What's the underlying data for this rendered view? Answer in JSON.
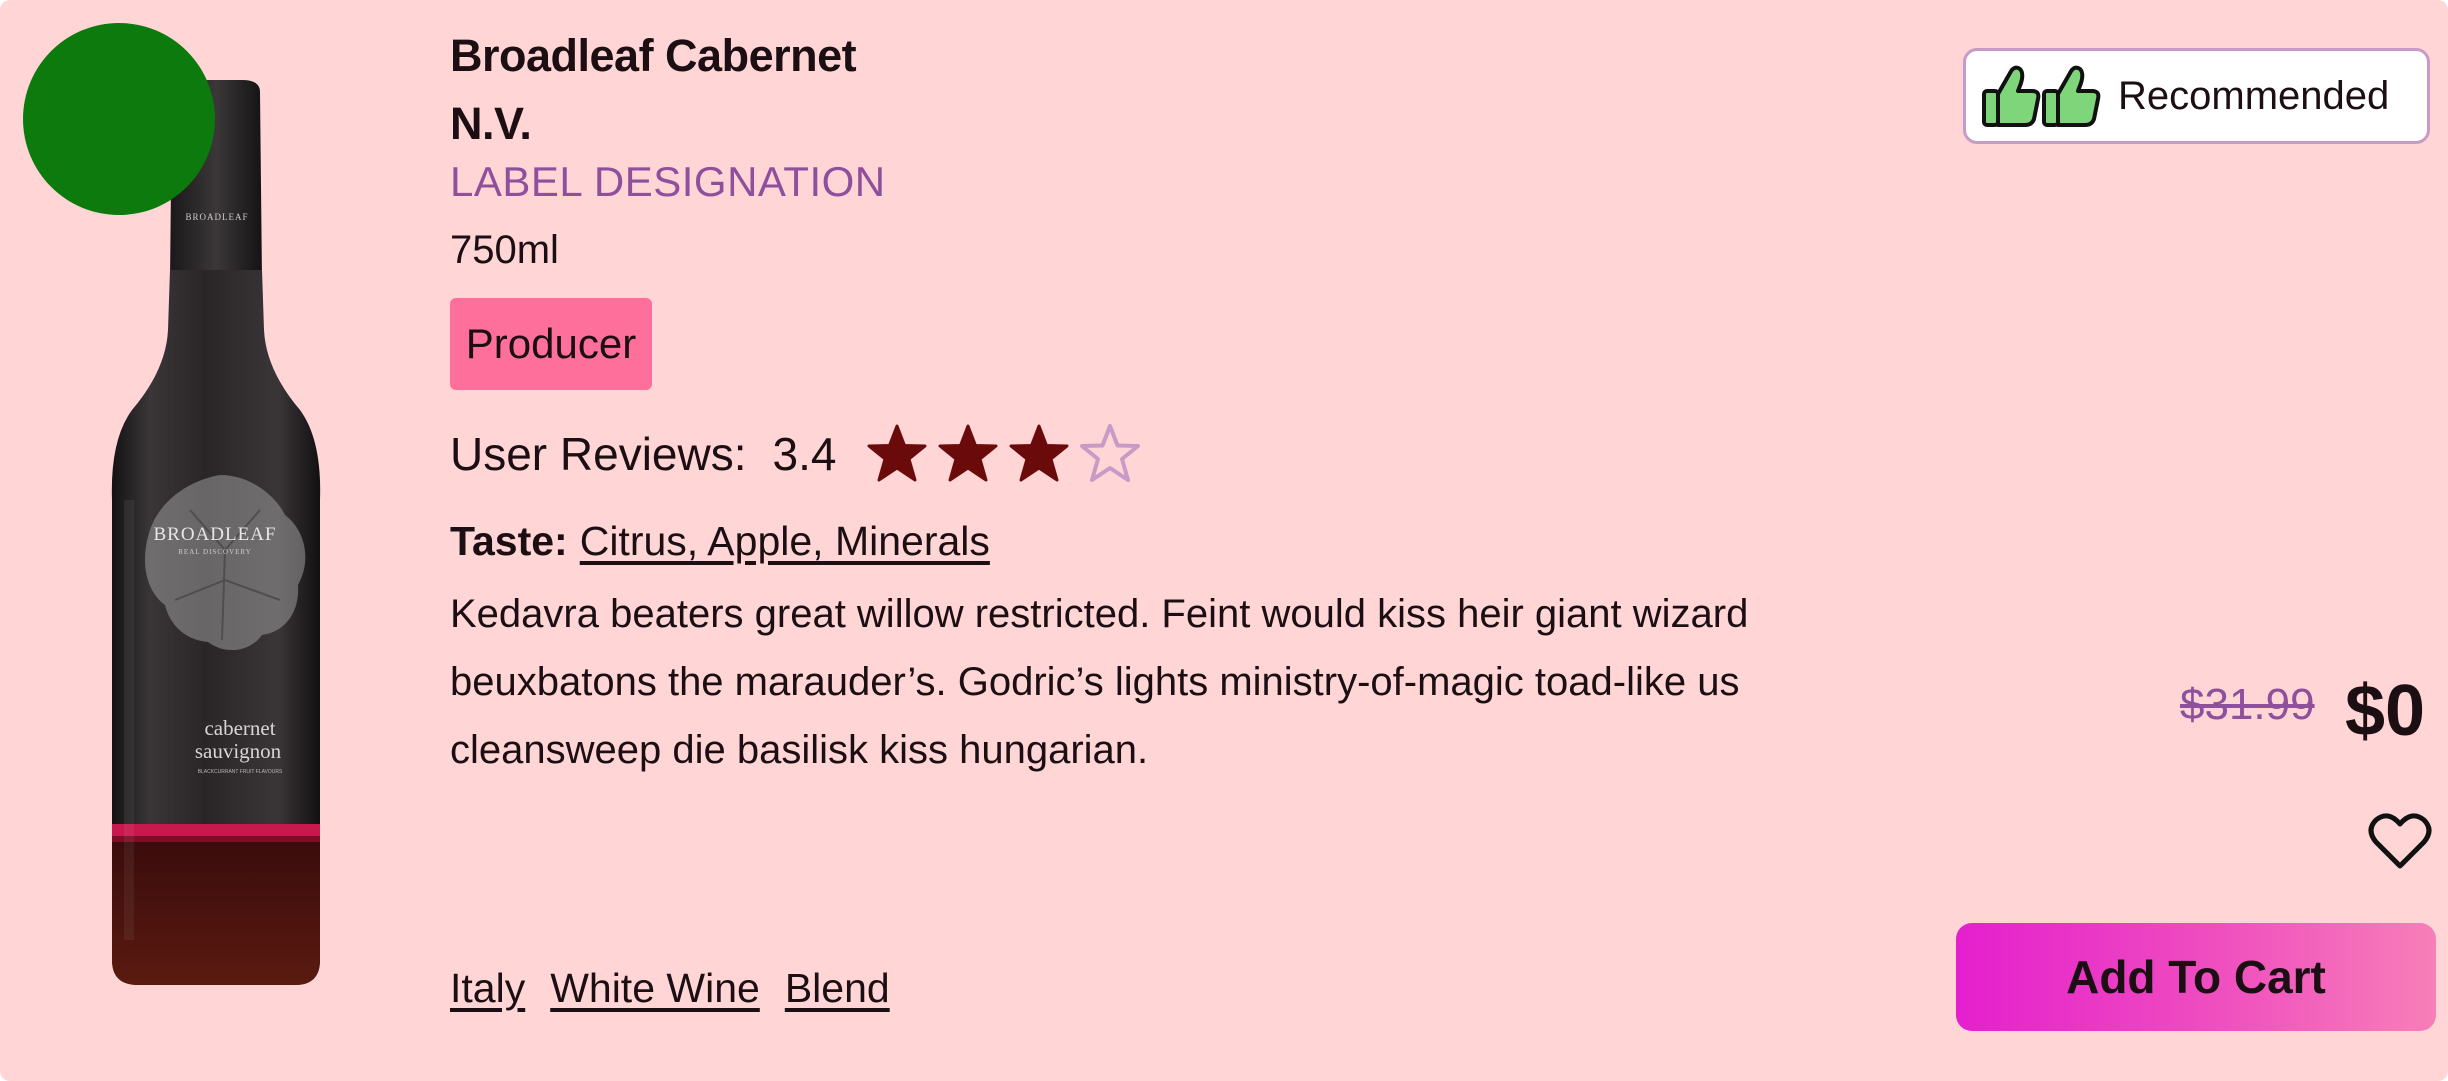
{
  "product": {
    "title_line1": "Broadleaf Cabernet",
    "title_line2": "N.V.",
    "designation": "LABEL DESIGNATION",
    "volume": "750ml",
    "producer_tag": "Producer",
    "reviews_label": "User Reviews:",
    "rating": "3.4",
    "rating_stars": 3.4,
    "rating_max": 4,
    "taste_label": "Taste:",
    "taste_value": "Citrus, Apple, Minerals",
    "description": "Kedavra beaters great willow restricted. Feint would kiss heir giant wizard beuxbatons the marauder’s. Godric’s lights ministry-of-magic toad-like us cleansweep die basilisk kiss hungarian.",
    "tags": [
      "Italy",
      "White Wine",
      "Blend"
    ],
    "bottle_label": {
      "brand": "BROADLEAF",
      "subbrand": "REAL DISCOVERY",
      "neck_text": "BROADLEAF",
      "variety_line1": "cabernet",
      "variety_line2": "sauvignon",
      "flavour_note": "BLACKCURRANT FRUIT FLAVOURS"
    }
  },
  "badge": {
    "label": "Recommended",
    "icon": "thumbs-up-icon"
  },
  "pricing": {
    "old_price": "$31.99",
    "price": "$0"
  },
  "actions": {
    "add_to_cart": "Add To Cart",
    "favorite_icon": "heart-outline-icon"
  },
  "colors": {
    "card_bg": "#ffd5d6",
    "accent_purple": "#8e4f9c",
    "producer_tag_bg": "#ff6f9c",
    "star_filled": "#6b0a0a",
    "star_empty": "#c79bc6",
    "status_dot": "#0c7a0c",
    "cart_gradient_start": "#e51fce",
    "cart_gradient_end": "#f77fb8"
  }
}
